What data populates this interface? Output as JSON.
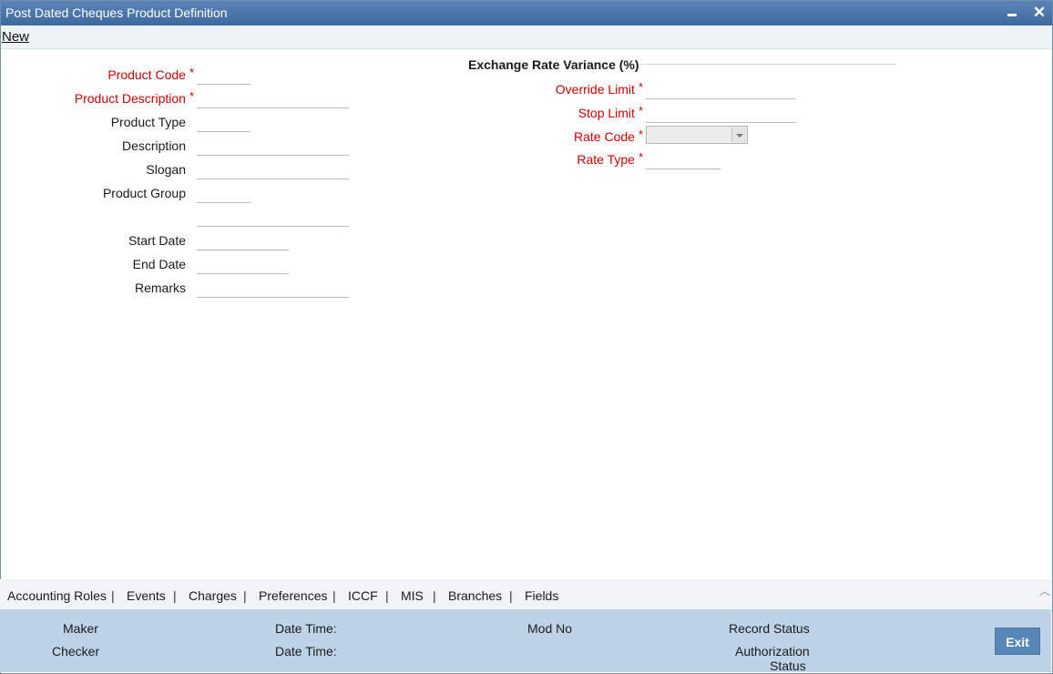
{
  "window": {
    "title": "Post Dated Cheques Product Definition"
  },
  "menu": {
    "new_label": "New"
  },
  "form": {
    "product_code": "Product Code",
    "product_description": "Product Description",
    "product_type": "Product Type",
    "description": "Description",
    "slogan": "Slogan",
    "product_group": "Product Group",
    "start_date": "Start Date",
    "end_date": "End Date",
    "remarks": "Remarks",
    "required_mark": "*"
  },
  "exchange": {
    "title": "Exchange Rate Variance (%)",
    "override_limit": "Override Limit",
    "stop_limit": "Stop Limit",
    "rate_code": "Rate Code",
    "rate_type": "Rate Type"
  },
  "tabs": [
    "Accounting Roles",
    "Events",
    "Charges",
    "Preferences",
    "ICCF",
    "MIS",
    "Branches",
    "Fields"
  ],
  "tab_separator": "|",
  "footer": {
    "maker": "Maker",
    "checker": "Checker",
    "date_time": "Date Time:",
    "mod_no": "Mod No",
    "record_status": "Record Status",
    "authorization": "Authorization",
    "status": "Status",
    "exit": "Exit"
  },
  "icons": {
    "minimize": "minimize-icon",
    "close": "close-icon",
    "collapse": "chevron-up-icon",
    "dropdown": "chevron-down-icon"
  },
  "colors": {
    "titlebar": "#4a75aa",
    "required": "#cc0000",
    "footer": "#bfd3e8",
    "exit_button": "#5886b6"
  }
}
